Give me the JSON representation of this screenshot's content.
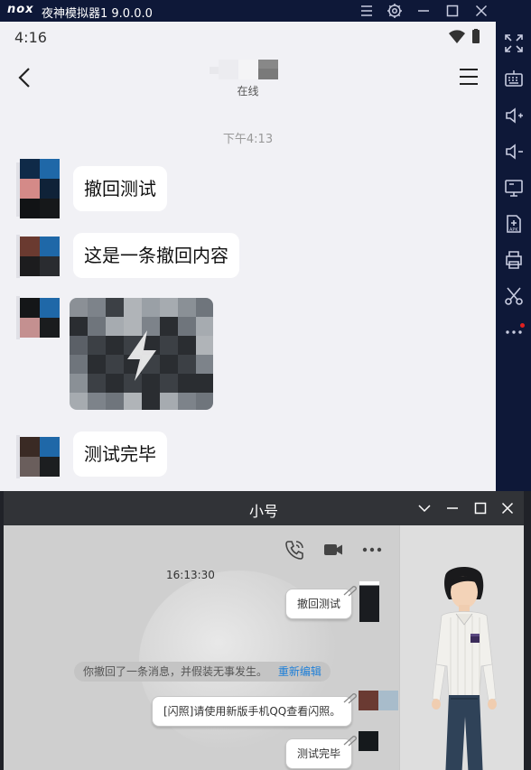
{
  "emulator": {
    "logo": "nox",
    "title": "夜神模拟器1 9.0.0.0",
    "controls": [
      "menu-icon",
      "settings-icon",
      "minimize-icon",
      "maximize-icon",
      "close-icon"
    ],
    "sidebar_icons": [
      "fullscreen-icon",
      "keyboard-icon",
      "volume-up-icon",
      "volume-down-icon",
      "screen-icon",
      "apk-install-icon",
      "print-icon",
      "scissors-icon",
      "more-icon"
    ],
    "bg_color": "#0e1838"
  },
  "phone": {
    "status_time": "4:16",
    "status_icons": [
      "wifi-icon",
      "battery-icon"
    ],
    "header": {
      "contact_status": "在线",
      "back_icon": "chevron-left-icon",
      "menu_icon": "hamburger-icon"
    },
    "chat_time": "下午4:13",
    "messages": [
      {
        "text": "撤回测试"
      },
      {
        "text": "这是一条撤回内容"
      },
      {
        "type": "flash-photo",
        "icon": "lightning-icon"
      },
      {
        "text": "测试完毕"
      }
    ]
  },
  "qq": {
    "title": "小号",
    "window_controls": [
      "chevron-down-icon",
      "minimize-icon",
      "maximize-icon",
      "close-icon"
    ],
    "tools": [
      "phone-icon",
      "video-icon",
      "more-icon"
    ],
    "time": "16:13:30",
    "msg_recall_test": "撤回测试",
    "recall_notice": "你撤回了一条消息，并假装无事发生。",
    "recall_edit_link": "重新编辑",
    "msg_flash_photo": "[闪照]请使用新版手机QQ查看闪照。",
    "msg_test_done": "测试完毕"
  }
}
